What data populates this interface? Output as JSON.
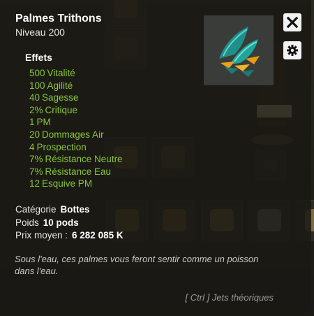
{
  "item": {
    "name": "Palmes Trithons",
    "level_label": "Niveau",
    "level_value": "200"
  },
  "effects": {
    "heading": "Effets",
    "items": [
      {
        "amount": "500",
        "stat": "Vitalité"
      },
      {
        "amount": "100",
        "stat": "Agilité"
      },
      {
        "amount": "40",
        "stat": "Sagesse"
      },
      {
        "amount": "2%",
        "stat": "Critique"
      },
      {
        "amount": "1",
        "stat": "PM"
      },
      {
        "amount": "20",
        "stat": "Dommages Air"
      },
      {
        "amount": "4",
        "stat": "Prospection"
      },
      {
        "amount": "7%",
        "stat": "Résistance Neutre"
      },
      {
        "amount": "7%",
        "stat": "Résistance Eau"
      },
      {
        "amount": "12",
        "stat": "Esquive PM"
      }
    ]
  },
  "info": {
    "category_label": "Catégorie",
    "category_value": "Bottes",
    "weight_label": "Poids",
    "weight_value": "10 pods",
    "price_label": "Prix moyen :",
    "price_value": "6 282 085 K"
  },
  "description": "Sous l'eau, ces palmes vous feront sentir comme un poisson dans l'eau.",
  "hint": "[ Ctrl ] Jets théoriques",
  "icons": {
    "close": "close-icon",
    "settings": "gear-icon",
    "item_image": "flippers-item-icon"
  },
  "colors": {
    "effect_text": "#88c639",
    "panel_bg": "#1a1814",
    "item_frame": "#3a3c39"
  }
}
